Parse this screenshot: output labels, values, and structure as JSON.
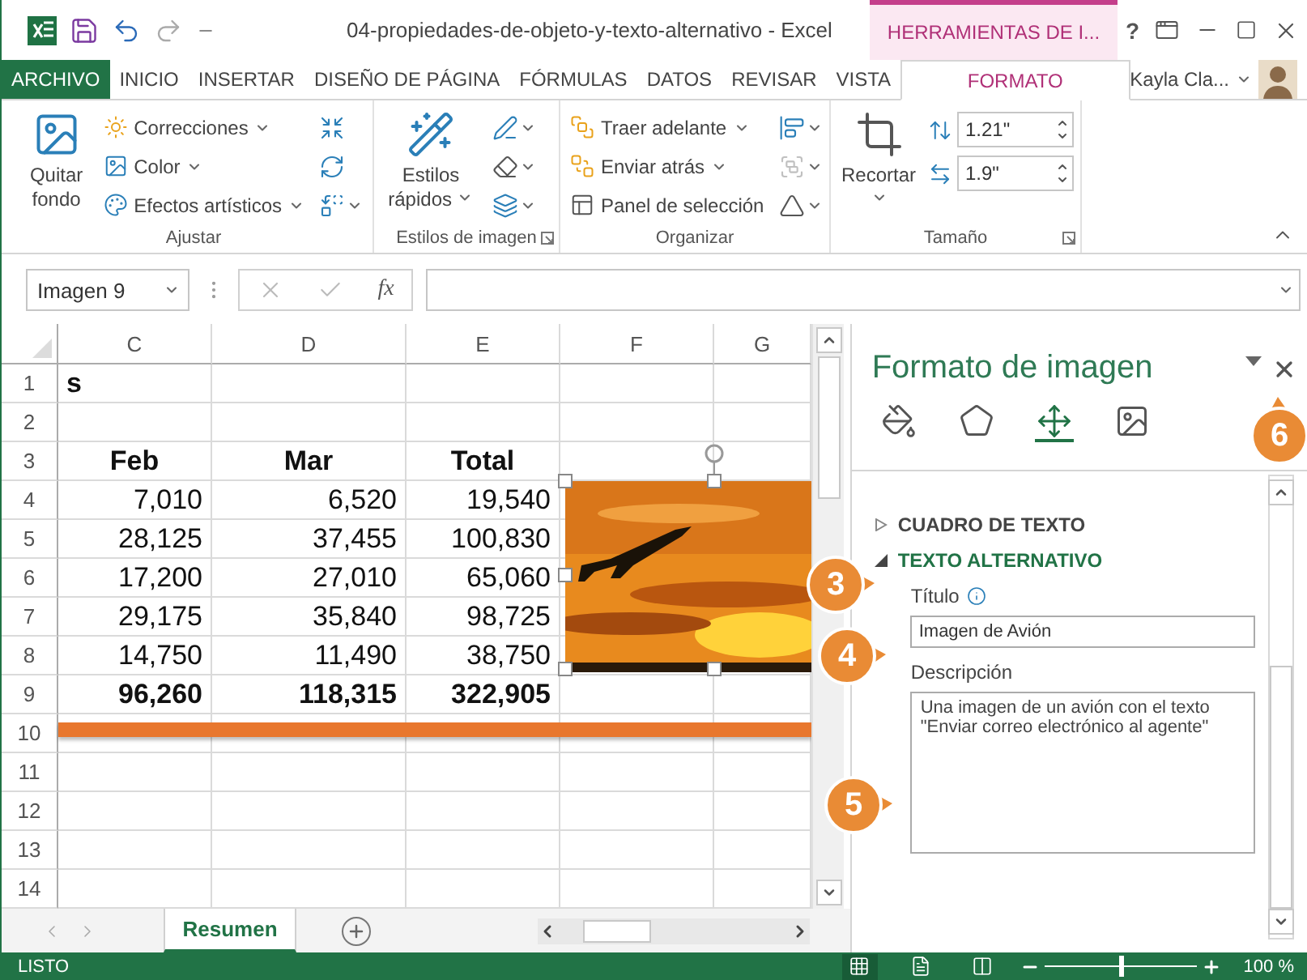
{
  "title_bar": {
    "title": "04-propiedades-de-objeto-y-texto-alternativo - Excel",
    "contextual_tab": "HERRAMIENTAS DE I...",
    "help": "?"
  },
  "ribbon_tabs": [
    {
      "label": "ARCHIVO",
      "kind": "file",
      "selected": false
    },
    {
      "label": "INICIO",
      "kind": "plain",
      "selected": false
    },
    {
      "label": "INSERTAR",
      "kind": "plain",
      "selected": false
    },
    {
      "label": "DISEÑO DE PÁGINA",
      "kind": "plain",
      "selected": false
    },
    {
      "label": "FÓRMULAS",
      "kind": "plain",
      "selected": false
    },
    {
      "label": "DATOS",
      "kind": "plain",
      "selected": false
    },
    {
      "label": "REVISAR",
      "kind": "plain",
      "selected": false
    },
    {
      "label": "VISTA",
      "kind": "plain",
      "selected": false
    },
    {
      "label": "FORMATO",
      "kind": "contextual",
      "selected": true
    }
  ],
  "user": {
    "name": "Kayla Cla..."
  },
  "ribbon_groups": [
    {
      "label": "Ajustar",
      "launcher": false,
      "large": [
        {
          "label": "Quitar fondo",
          "dropdown": false
        }
      ],
      "items": [
        {
          "label": "Correcciones",
          "dropdown": true
        },
        {
          "label": "Color",
          "dropdown": true
        },
        {
          "label": "Efectos artísticos",
          "dropdown": true
        }
      ],
      "icon_column": [
        {
          "dropdown": false,
          "disabled": false
        },
        {
          "dropdown": false,
          "disabled": false
        },
        {
          "dropdown": true,
          "disabled": false
        }
      ]
    },
    {
      "label": "Estilos de imagen",
      "launcher": true,
      "large": [
        {
          "label": "Estilos rápidos",
          "dropdown": true
        }
      ],
      "icon_column": [
        {
          "dropdown": true,
          "disabled": false
        },
        {
          "dropdown": true,
          "disabled": false
        },
        {
          "dropdown": true,
          "disabled": false
        }
      ]
    },
    {
      "label": "Organizar",
      "launcher": false,
      "items": [
        {
          "label": "Traer adelante",
          "dropdown": true
        },
        {
          "label": "Enviar atrás",
          "dropdown": true
        },
        {
          "label": "Panel de selección",
          "dropdown": false
        }
      ],
      "icon_column": [
        {
          "dropdown": true,
          "disabled": false
        },
        {
          "dropdown": true,
          "disabled": true
        },
        {
          "dropdown": true,
          "disabled": false
        }
      ]
    },
    {
      "label": "Tamaño",
      "launcher": true,
      "large": [
        {
          "label": "Recortar",
          "dropdown": true
        }
      ],
      "spinners": [
        {
          "value": "1.21\""
        },
        {
          "value": "1.9\""
        }
      ]
    }
  ],
  "formula_bar": {
    "name_box": "Imagen 9",
    "function_label": "fx"
  },
  "sheet": {
    "columns": [
      "C",
      "D",
      "E",
      "F",
      "G"
    ],
    "rows": [
      {
        "number": "1",
        "kind": "title",
        "cells": [
          "s"
        ]
      },
      {
        "number": "2",
        "kind": "empty"
      },
      {
        "number": "3",
        "kind": "header",
        "cells": [
          "Feb",
          "Mar",
          "Total"
        ]
      },
      {
        "number": "4",
        "kind": "number",
        "cells": [
          "7,010",
          "6,520",
          "19,540"
        ]
      },
      {
        "number": "5",
        "kind": "number",
        "cells": [
          "28,125",
          "37,455",
          "100,830"
        ]
      },
      {
        "number": "6",
        "kind": "number",
        "cells": [
          "17,200",
          "27,010",
          "65,060"
        ]
      },
      {
        "number": "7",
        "kind": "number",
        "cells": [
          "29,175",
          "35,840",
          "98,725"
        ]
      },
      {
        "number": "8",
        "kind": "number",
        "cells": [
          "14,750",
          "11,490",
          "38,750"
        ]
      },
      {
        "number": "9",
        "kind": "total",
        "cells": [
          "96,260",
          "118,315",
          "322,905"
        ]
      },
      {
        "number": "10",
        "kind": "empty"
      },
      {
        "number": "11",
        "kind": "empty"
      },
      {
        "number": "12",
        "kind": "empty"
      },
      {
        "number": "13",
        "kind": "empty"
      },
      {
        "number": "14",
        "kind": "empty"
      }
    ],
    "picture": {
      "kind": "picture",
      "selected": true
    }
  },
  "sheet_tabs": [
    {
      "label": "Resumen",
      "selected": true
    }
  ],
  "status_bar": {
    "text": "LISTO",
    "views": [
      {
        "selected": true
      },
      {
        "selected": false
      },
      {
        "selected": false
      }
    ],
    "zoom_slider": {
      "level": 0.5
    },
    "zoom": "100 %"
  },
  "pane": {
    "title": "Formato de imagen",
    "tabs": [
      {
        "selected": false
      },
      {
        "selected": false
      },
      {
        "selected": true
      },
      {
        "selected": false
      }
    ],
    "sections": [
      {
        "label": "CUADRO DE TEXTO",
        "expanded": false
      },
      {
        "label": "TEXTO ALTERNATIVO",
        "expanded": true,
        "fields": [
          {
            "label": "Título",
            "info": true,
            "kind": "line",
            "value": "Imagen de Avión"
          },
          {
            "label": "Descripción",
            "info": false,
            "kind": "area",
            "value": "Una imagen de un avión con el texto\n\"Enviar correo electrónico al agente\""
          }
        ]
      }
    ]
  },
  "callouts": [
    "3",
    "4",
    "5",
    "6"
  ]
}
